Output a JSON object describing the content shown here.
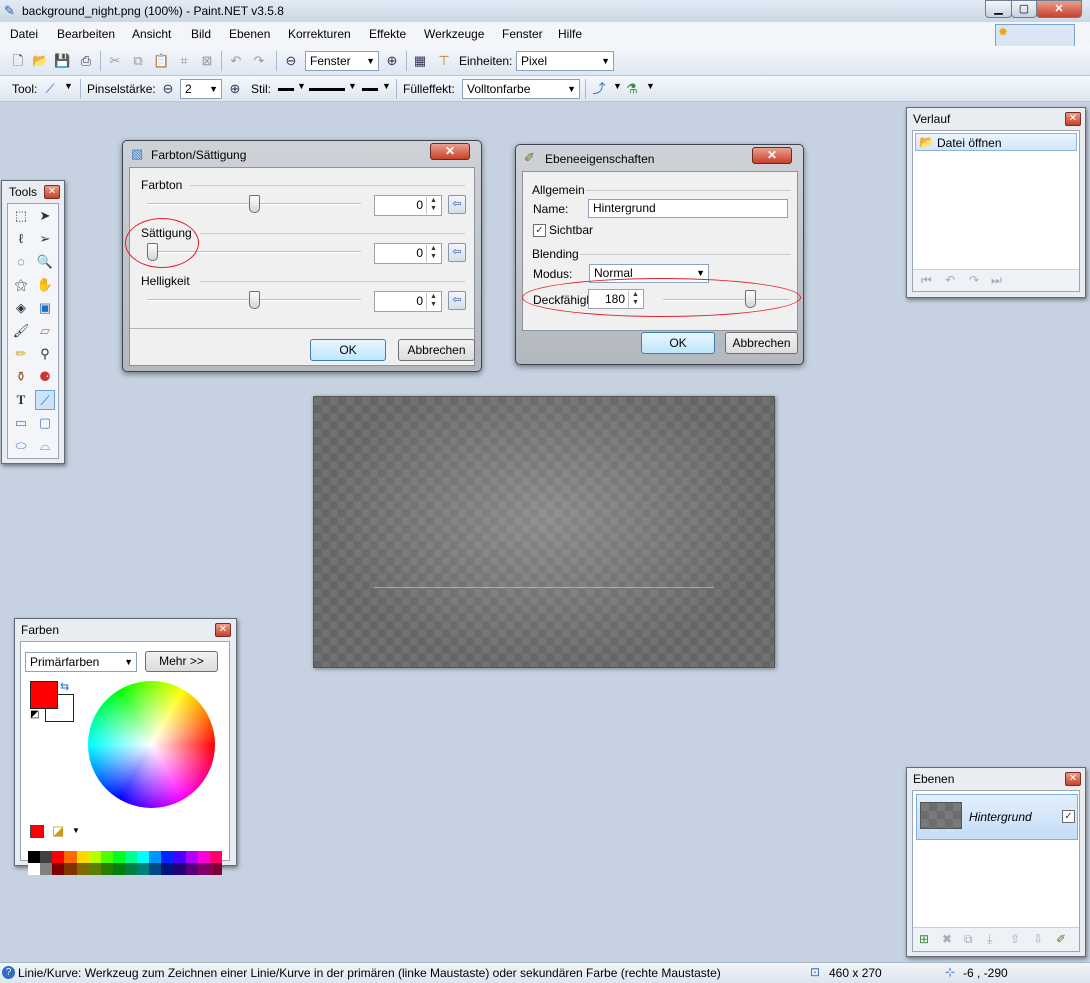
{
  "window": {
    "title": "background_night.png (100%) - Paint.NET v3.5.8"
  },
  "menu": [
    "Datei",
    "Bearbeiten",
    "Ansicht",
    "Bild",
    "Ebenen",
    "Korrekturen",
    "Effekte",
    "Werkzeuge",
    "Fenster",
    "Hilfe"
  ],
  "toolbar1": {
    "zoom_value": "Fenster",
    "units_label": "Einheiten:",
    "units_value": "Pixel"
  },
  "toolbar2": {
    "tool_label": "Tool:",
    "brush_label": "Pinselstärke:",
    "brush_value": "2",
    "style_label": "Stil:",
    "fill_label": "Fülleffekt:",
    "fill_value": "Volltonfarbe"
  },
  "tools_panel": {
    "title": "Tools"
  },
  "hue_dialog": {
    "title": "Farbton/Sättigung",
    "hue_label": "Farbton",
    "hue_value": "0",
    "sat_label": "Sättigung",
    "sat_value": "0",
    "light_label": "Helligkeit",
    "light_value": "0",
    "ok": "OK",
    "cancel": "Abbrechen"
  },
  "layer_dialog": {
    "title": "Ebeneeigenschaften",
    "general": "Allgemein",
    "name_label": "Name:",
    "name_value": "Hintergrund",
    "visible": "Sichtbar",
    "blending": "Blending",
    "mode_label": "Modus:",
    "mode_value": "Normal",
    "opacity_label": "Deckfähigk",
    "opacity_value": "180",
    "ok": "OK",
    "cancel": "Abbrechen"
  },
  "history_panel": {
    "title": "Verlauf",
    "item": "Datei öffnen"
  },
  "colors_panel": {
    "title": "Farben",
    "mode": "Primärfarben",
    "more": "Mehr >>",
    "primary": "#ff0000",
    "secondary": "#ffffff"
  },
  "layers_panel": {
    "title": "Ebenen",
    "layer_name": "Hintergrund"
  },
  "status": {
    "hint": "Linie/Kurve: Werkzeug zum Zeichnen einer Linie/Kurve in der primären (linke Maustaste) oder sekundären Farbe (rechte Maustaste)",
    "size": "460 x 270",
    "pos": "-6 , -290"
  }
}
